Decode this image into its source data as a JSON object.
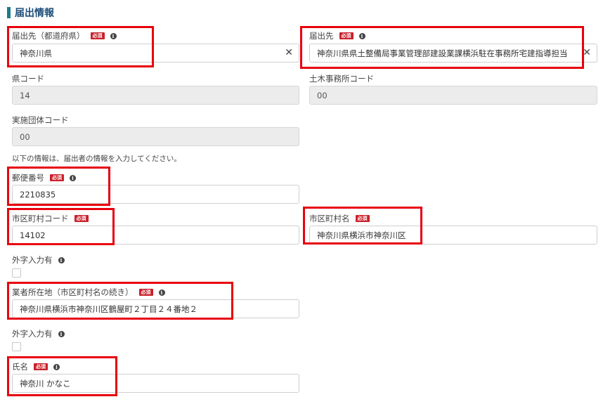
{
  "section": {
    "title": "届出情報"
  },
  "fields": {
    "prefecture": {
      "label": "届出先（都道府県）",
      "required": "必須",
      "value": "神奈川県"
    },
    "office": {
      "label": "届出先",
      "required": "必須",
      "value": "神奈川県県土整備局事業管理部建設業課横浜駐在事務所宅建指導担当"
    },
    "pref_code": {
      "label": "県コード",
      "value": "14"
    },
    "civil_code": {
      "label": "土木事務所コード",
      "value": "00"
    },
    "org_code": {
      "label": "実施団体コード",
      "value": "00"
    },
    "note": "以下の情報は、届出者の情報を入力してください。",
    "postal": {
      "label": "郵便番号",
      "required": "必須",
      "value": "2210835"
    },
    "city_code": {
      "label": "市区町村コード",
      "required": "必須",
      "value": "14102"
    },
    "city_name": {
      "label": "市区町村名",
      "required": "必須",
      "value": "神奈川県横浜市神奈川区"
    },
    "gaiji1": {
      "label": "外字入力有"
    },
    "address": {
      "label": "業者所在地（市区町村名の続き）",
      "required": "必須",
      "value": "神奈川県横浜市神奈川区鶴屋町２丁目２４番地２"
    },
    "gaiji2": {
      "label": "外字入力有"
    },
    "name": {
      "label": "氏名",
      "required": "必須",
      "value": "神奈川 かなこ"
    }
  },
  "icons": {
    "info": "info-icon",
    "clear": "close-icon"
  },
  "colors": {
    "highlight": "#e8000d",
    "required_badge": "#c9202a",
    "section_bar": "#1f7a8c"
  }
}
